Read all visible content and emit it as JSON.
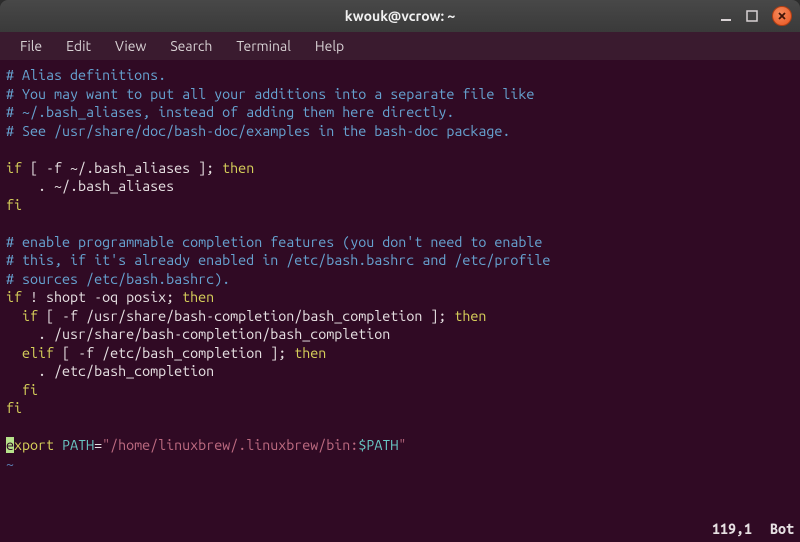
{
  "window": {
    "title": "kwouk@vcrow: ~"
  },
  "menubar": {
    "items": [
      "File",
      "Edit",
      "View",
      "Search",
      "Terminal",
      "Help"
    ]
  },
  "content": {
    "l01": "# Alias definitions.",
    "l02": "# You may want to put all your additions into a separate file like",
    "l03": "# ~/.bash_aliases, instead of adding them here directly.",
    "l04": "# See /usr/share/doc/bash-doc/examples in the bash-doc package.",
    "l05": " ",
    "l06a": "if",
    "l06b": " [ -f ~/.bash_aliases ]; ",
    "l06c": "then",
    "l07": "    . ~/.bash_aliases",
    "l08": "fi",
    "l09": " ",
    "l10": "# enable programmable completion features (you don't need to enable",
    "l11": "# this, if it's already enabled in /etc/bash.bashrc and /etc/profile",
    "l12": "# sources /etc/bash.bashrc).",
    "l13a": "if",
    "l13b": " ! shopt -oq posix; ",
    "l13c": "then",
    "l14a": "  if",
    "l14b": " [ -f /usr/share/bash-completion/bash_completion ]; ",
    "l14c": "then",
    "l15": "    . /usr/share/bash-completion/bash_completion",
    "l16a": "  elif",
    "l16b": " [ -f /etc/bash_completion ]; ",
    "l16c": "then",
    "l17": "    . /etc/bash_completion",
    "l18": "  fi",
    "l19": "fi",
    "l20": " ",
    "l21cursor": "e",
    "l21a": "xport ",
    "l21b": "PATH",
    "l21c": "=",
    "l21d": "\"/home/linuxbrew/.linuxbrew/bin:",
    "l21e": "$PATH",
    "l21f": "\"",
    "l22": "~"
  },
  "status": {
    "pos": "119,1",
    "scroll": "Bot"
  }
}
